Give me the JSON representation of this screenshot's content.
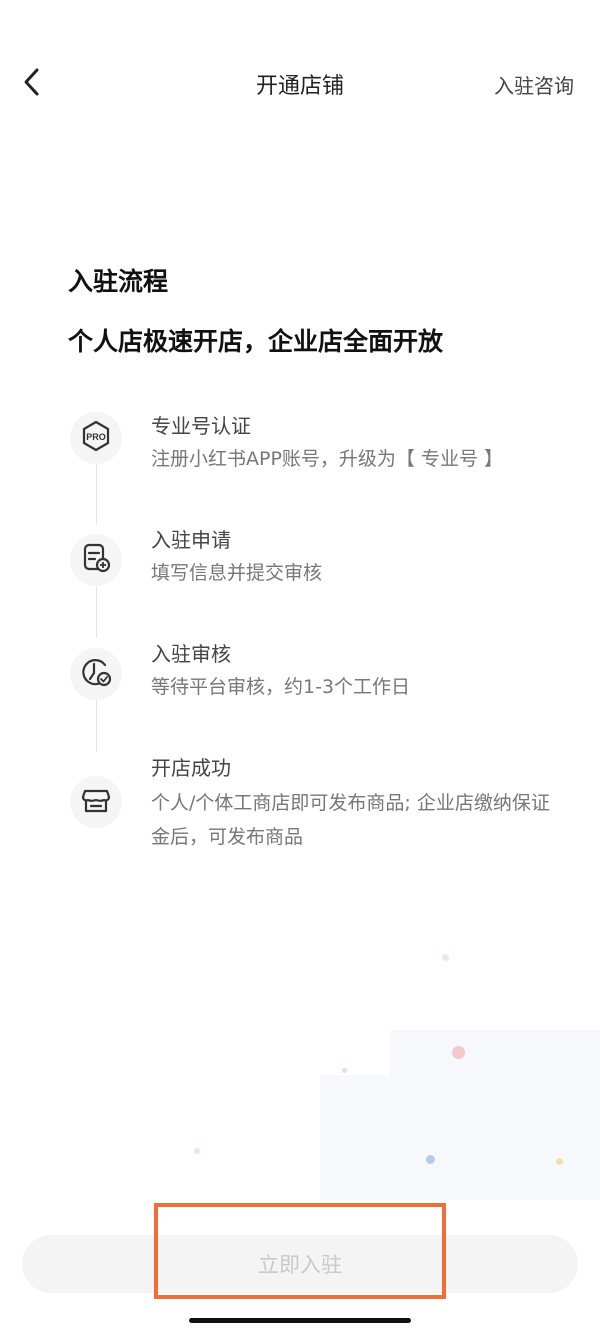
{
  "nav": {
    "title": "开通店铺",
    "right_link": "入驻咨询",
    "back_icon": "chevron-left-icon"
  },
  "intro": {
    "title": "入驻流程",
    "subtitle": "个人店极速开店，企业店全面开放"
  },
  "steps": [
    {
      "icon": "pro-badge-icon",
      "title": "专业号认证",
      "desc": "注册小红书APP账号，升级为【 专业号 】"
    },
    {
      "icon": "form-add-icon",
      "title": "入驻申请",
      "desc": "填写信息并提交审核"
    },
    {
      "icon": "clock-check-icon",
      "title": "入驻审核",
      "desc": "等待平台审核，约1-3个工作日"
    },
    {
      "icon": "store-icon",
      "title": "开店成功",
      "desc": "个人/个体工商店即可发布商品; 企业店缴纳保证金后，可发布商品"
    }
  ],
  "cta": {
    "label": "立即入驻",
    "state": "disabled"
  },
  "colors": {
    "highlight_border": "#ef6e3a",
    "cta_bg": "#f4f4f4",
    "cta_text": "#c9c9c9",
    "dot_red": "#f4c7c9",
    "dot_blue": "#b9c9ea",
    "dot_yellow": "#f1dfb2"
  }
}
